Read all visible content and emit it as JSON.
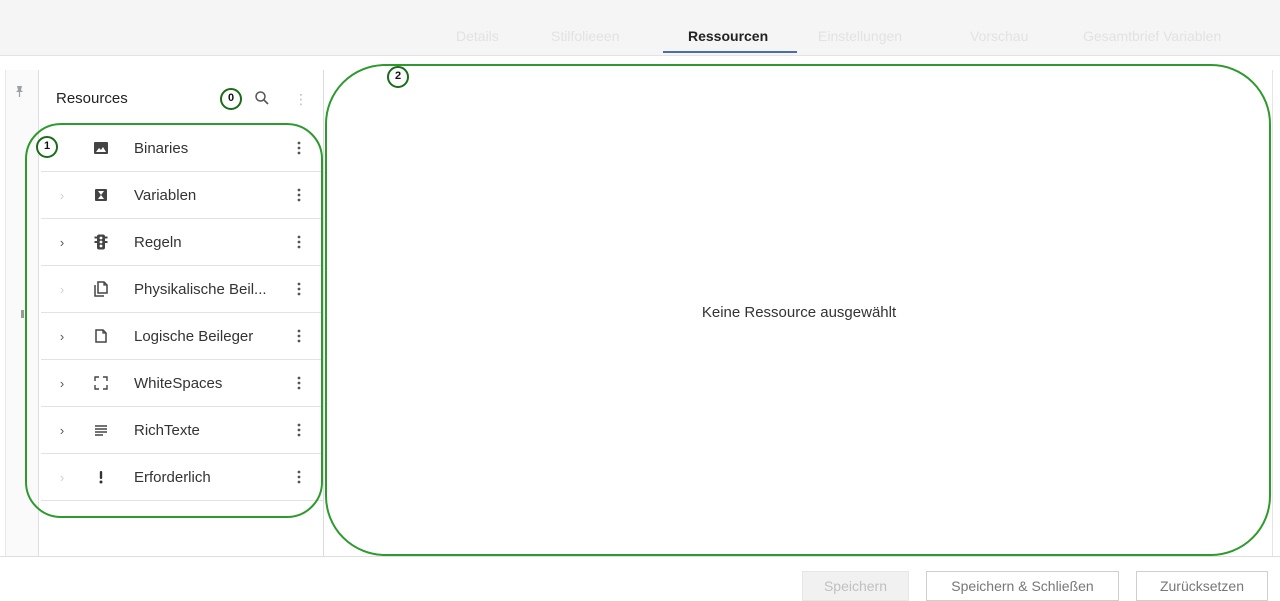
{
  "tabs": [
    {
      "label": "Details",
      "active": false
    },
    {
      "label": "Stilfolieeen",
      "active": false
    },
    {
      "label": "Ressourcen",
      "active": true
    },
    {
      "label": "Einstellungen",
      "active": false
    },
    {
      "label": "Vorschau",
      "active": false
    },
    {
      "label": "Gesamtbrief Variablen",
      "active": false
    }
  ],
  "resources_panel": {
    "title": "Resources",
    "count_badge": "0",
    "items": [
      {
        "label": "Binaries",
        "icon": "image-icon",
        "expandable": false
      },
      {
        "label": "Variablen",
        "icon": "variable-icon",
        "expandable": false
      },
      {
        "label": "Regeln",
        "icon": "traffic-light-icon",
        "expandable": true
      },
      {
        "label": "Physikalische Beil...",
        "icon": "copy-document-icon",
        "expandable": false
      },
      {
        "label": "Logische Beileger",
        "icon": "document-icon",
        "expandable": true
      },
      {
        "label": "WhiteSpaces",
        "icon": "fullscreen-corners-icon",
        "expandable": true
      },
      {
        "label": "RichTexte",
        "icon": "text-lines-icon",
        "expandable": true
      },
      {
        "label": "Erforderlich",
        "icon": "exclamation-icon",
        "expandable": false
      }
    ]
  },
  "annotations": {
    "list_badge": "1",
    "main_badge": "2"
  },
  "main": {
    "empty_message": "Keine Ressource ausgewählt"
  },
  "footer": {
    "save_label": "Speichern",
    "save_close_label": "Speichern & Schließen",
    "reset_label": "Zurücksetzen"
  },
  "colors": {
    "annotation_green": "#2e9a2e",
    "tab_underline": "#4a6fa5"
  }
}
